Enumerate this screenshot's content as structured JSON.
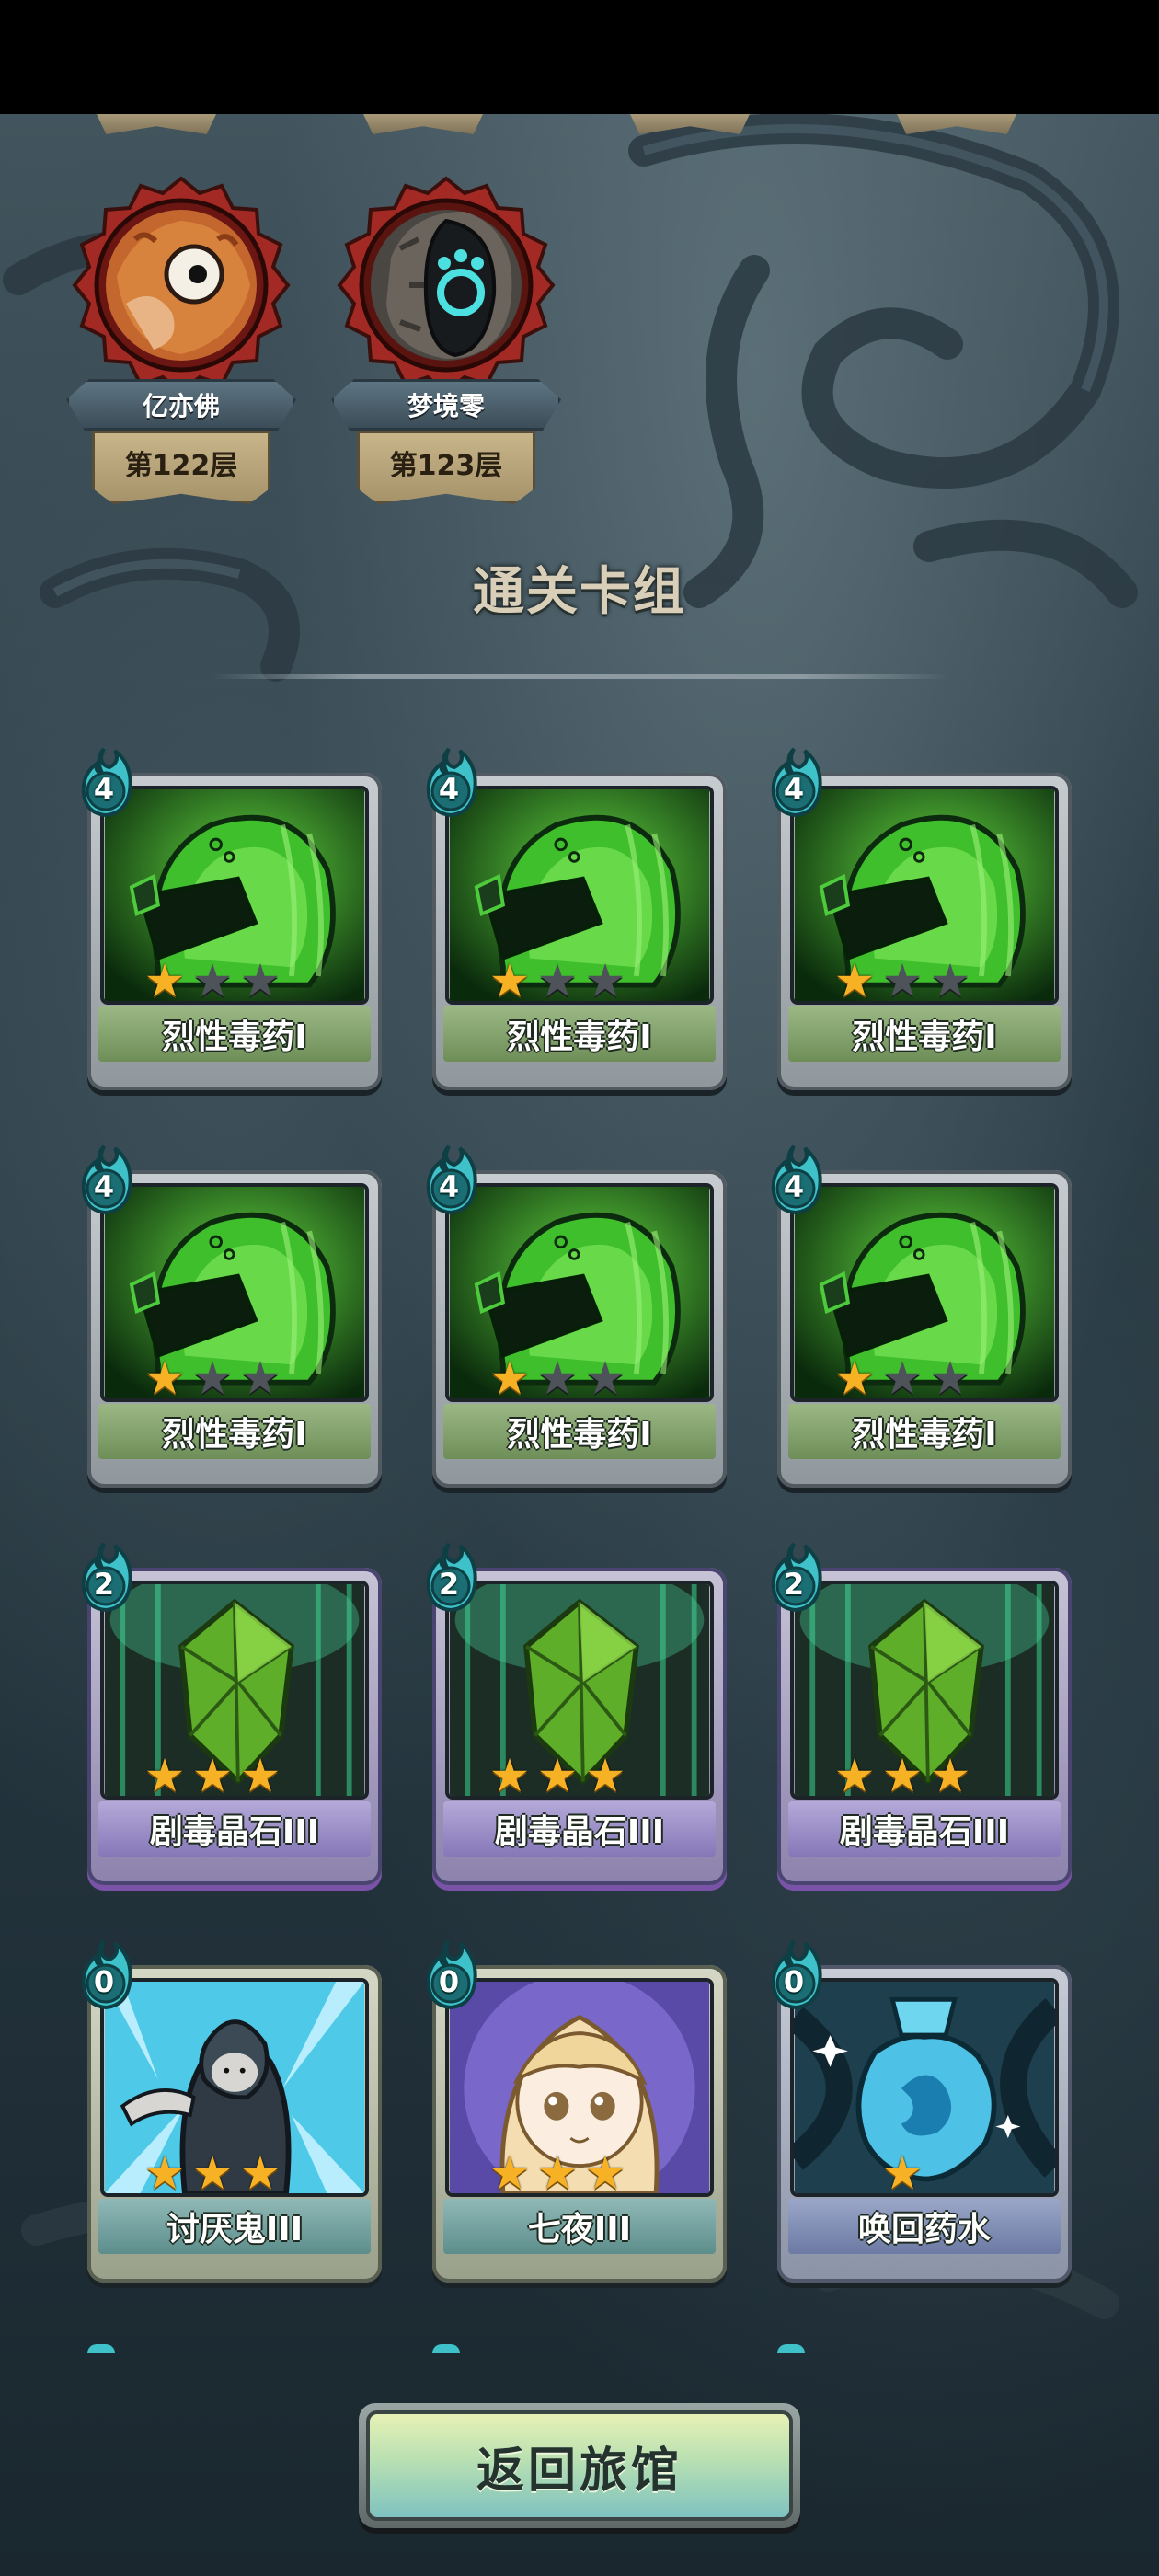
{
  "bosses": [
    {
      "name": "亿亦佛",
      "floor": "第122层",
      "portrait_icon": "fire-eye-monster-portrait"
    },
    {
      "name": "梦境零",
      "floor": "第123层",
      "portrait_icon": "armored-paw-mask-portrait"
    }
  ],
  "section_title": "通关卡组",
  "cards": [
    {
      "cost": "4",
      "name": "烈性毒药I",
      "stars": 1,
      "art": "poison-potion",
      "rarity": "green"
    },
    {
      "cost": "4",
      "name": "烈性毒药I",
      "stars": 1,
      "art": "poison-potion",
      "rarity": "green"
    },
    {
      "cost": "4",
      "name": "烈性毒药I",
      "stars": 1,
      "art": "poison-potion",
      "rarity": "green"
    },
    {
      "cost": "4",
      "name": "烈性毒药I",
      "stars": 1,
      "art": "poison-potion",
      "rarity": "green"
    },
    {
      "cost": "4",
      "name": "烈性毒药I",
      "stars": 1,
      "art": "poison-potion",
      "rarity": "green"
    },
    {
      "cost": "4",
      "name": "烈性毒药I",
      "stars": 1,
      "art": "poison-potion",
      "rarity": "green"
    },
    {
      "cost": "2",
      "name": "剧毒晶石III",
      "stars": 3,
      "art": "poison-crystal",
      "rarity": "purple"
    },
    {
      "cost": "2",
      "name": "剧毒晶石III",
      "stars": 3,
      "art": "poison-crystal",
      "rarity": "purple"
    },
    {
      "cost": "2",
      "name": "剧毒晶石III",
      "stars": 3,
      "art": "poison-crystal",
      "rarity": "purple"
    },
    {
      "cost": "0",
      "name": "讨厌鬼III",
      "stars": 3,
      "art": "hooded-figure",
      "rarity": "teal"
    },
    {
      "cost": "0",
      "name": "七夜III",
      "stars": 3,
      "art": "blonde-girl",
      "rarity": "teal"
    },
    {
      "cost": "0",
      "name": "唤回药水",
      "stars": 1,
      "art": "recall-potion",
      "rarity": "blue"
    }
  ],
  "return_button": "返回旅馆",
  "colors": {
    "star_on": "#f7b125",
    "star_off": "#4d5359",
    "cost_flame": "#3ec1c9"
  }
}
